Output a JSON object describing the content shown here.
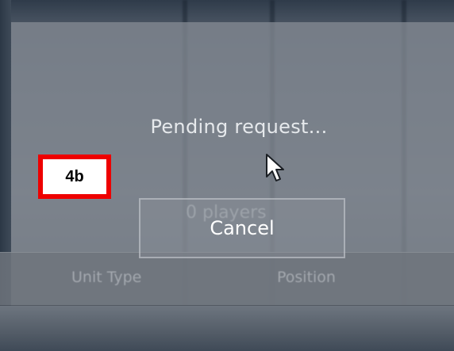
{
  "dialog": {
    "status_text": "Pending request...",
    "cancel_label": "Cancel"
  },
  "background": {
    "players_text": "0 players",
    "columns": [
      "Unit Type",
      "Position"
    ]
  },
  "annotation": {
    "step_label": "4b",
    "border_color": "#ee0000"
  },
  "icons": {
    "cursor": "mouse-pointer-icon"
  }
}
